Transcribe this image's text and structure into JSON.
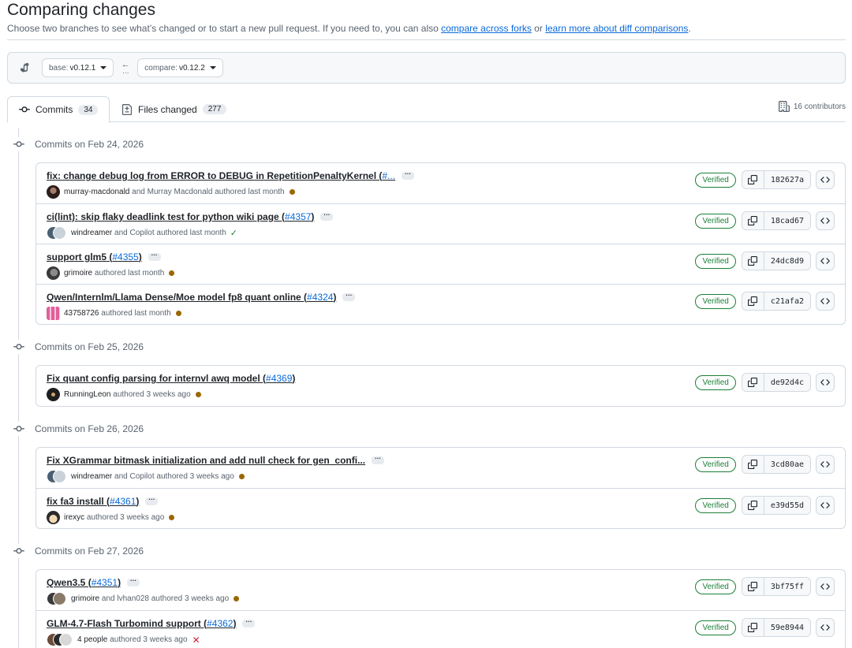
{
  "header": {
    "title": "Comparing changes",
    "subtitle_text": "Choose two branches to see what’s changed or to start a new pull request. If you need to, you can also",
    "link_forks": "compare across forks",
    "or_text": "or",
    "link_learn": "learn more about diff comparisons",
    "period": "."
  },
  "range": {
    "base_prefix": "base:",
    "base_value": "v0.12.1",
    "compare_prefix": "compare:",
    "compare_value": "v0.12.2"
  },
  "tabs": {
    "commits_label": "Commits",
    "commits_count": "34",
    "files_label": "Files changed",
    "files_count": "277",
    "contributors": "16 contributors"
  },
  "groups": [
    {
      "date": "Commits on Feb 24, 2026",
      "commits": [
        {
          "title": "fix: change debug log from ERROR to DEBUG in RepetitionPenaltyKernel (",
          "pr": "#...",
          "close": "",
          "author": "murray-macdonald",
          "coauthor": "and Murray Macdonald",
          "time": "authored last month",
          "status": "pending",
          "verified": "Verified",
          "sha": "182627a"
        },
        {
          "title": "ci(lint): skip flaky deadlink test for python wiki page (",
          "pr": "#4357",
          "close": ")",
          "author": "windreamer",
          "coauthor": "and Copilot",
          "time": "authored last month",
          "status": "success",
          "verified": "Verified",
          "sha": "18cad67"
        },
        {
          "title": "support glm5 (",
          "pr": "#4355",
          "close": ")",
          "author": "grimoire",
          "coauthor": "",
          "time": "authored last month",
          "status": "pending",
          "verified": "Verified",
          "sha": "24dc8d9"
        },
        {
          "title": "Qwen/Internlm/Llama Dense/Moe model fp8 quant online (",
          "pr": "#4324",
          "close": ")",
          "author": "43758726",
          "coauthor": "",
          "time": "authored last month",
          "status": "pending",
          "verified": "Verified",
          "sha": "c21afa2"
        }
      ]
    },
    {
      "date": "Commits on Feb 25, 2026",
      "commits": [
        {
          "title": "Fix quant config parsing for internvl awq model (",
          "pr": "#4369",
          "close": ")",
          "author": "RunningLeon",
          "coauthor": "",
          "time": "authored 3 weeks ago",
          "status": "pending",
          "verified": "Verified",
          "sha": "de92d4c"
        }
      ]
    },
    {
      "date": "Commits on Feb 26, 2026",
      "commits": [
        {
          "title": "Fix XGrammar bitmask initialization and add null check for gen_confi...",
          "pr": "",
          "close": "",
          "author": "windreamer",
          "coauthor": "and Copilot",
          "time": "authored 3 weeks ago",
          "status": "pending",
          "verified": "Verified",
          "sha": "3cd80ae"
        },
        {
          "title": "fix fa3 install (",
          "pr": "#4361",
          "close": ")",
          "author": "irexyc",
          "coauthor": "",
          "time": "authored 3 weeks ago",
          "status": "pending",
          "verified": "Verified",
          "sha": "e39d55d"
        }
      ]
    },
    {
      "date": "Commits on Feb 27, 2026",
      "commits": [
        {
          "title": "Qwen3.5 (",
          "pr": "#4351",
          "close": ")",
          "author": "grimoire",
          "coauthor": "and lvhan028",
          "time": "authored 3 weeks ago",
          "status": "pending",
          "verified": "Verified",
          "sha": "3bf75ff"
        },
        {
          "title": "GLM-4.7-Flash Turbomind support (",
          "pr": "#4362",
          "close": ")",
          "author": "4 people",
          "coauthor": "",
          "time": "authored 3 weeks ago",
          "status": "failure",
          "verified": "Verified",
          "sha": "59e8944"
        }
      ]
    }
  ],
  "colors": {
    "link": "#0969da",
    "verified": "#1a7f37",
    "pending": "#9a6700",
    "failure": "#d1242f"
  }
}
